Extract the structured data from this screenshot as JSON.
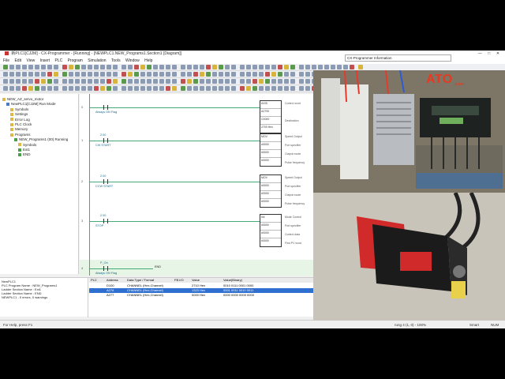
{
  "window": {
    "title": "新PLC1[CJ2M] - CX-Programmer - [Running] - [NEWPLC1.NEW_Programs1.Section1 [Diagram]]",
    "controls": [
      "—",
      "□",
      "✕"
    ]
  },
  "menu": [
    "File",
    "Edit",
    "View",
    "Insert",
    "PLC",
    "Program",
    "Simulation",
    "Tools",
    "Window",
    "Help"
  ],
  "dialog_title": "CX-Programmer Information",
  "tree": [
    {
      "label": "NEW_AZ_servo_motor",
      "indent": 0,
      "icon": "folder"
    },
    {
      "label": "NewPLC1[CJ2M] Run Mode",
      "indent": 1,
      "icon": "plc"
    },
    {
      "label": "Symbols",
      "indent": 2,
      "icon": "table"
    },
    {
      "label": "Settings",
      "indent": 2,
      "icon": "table"
    },
    {
      "label": "Error Log",
      "indent": 2,
      "icon": "table"
    },
    {
      "label": "PLC Clock",
      "indent": 2,
      "icon": "table"
    },
    {
      "label": "Memory",
      "indent": 2,
      "icon": "table"
    },
    {
      "label": "Programs",
      "indent": 2,
      "icon": "folder"
    },
    {
      "label": "NEW_Programs1 (00) Running",
      "indent": 3,
      "icon": "prog"
    },
    {
      "label": "Symbols",
      "indent": 4,
      "icon": "table"
    },
    {
      "label": "Ext1",
      "indent": 4,
      "icon": "prog"
    },
    {
      "label": "END",
      "indent": 4,
      "icon": "prog"
    }
  ],
  "rungs": [
    {
      "num": "0",
      "contact_addr": "",
      "contact_name": "Always ON Flag",
      "block": [
        "AXIS",
        "A2700",
        "C0000",
        "2700 Hex"
      ],
      "notes": [
        "Control word",
        "",
        "Destination",
        ""
      ]
    },
    {
      "num": "1",
      "contact_addr": "2.00",
      "contact_name": "CW START",
      "block": [
        "MOV",
        "#0000",
        "#0000",
        "#0000"
      ],
      "notes": [
        "Speed Output",
        "Port specifier",
        "Output mode",
        "Pulse frequency"
      ]
    },
    {
      "num": "2",
      "contact_addr": "2.00",
      "contact_name": "CCW START",
      "block": [
        "MOV",
        "#0000",
        "#0000",
        "#0000"
      ],
      "notes": [
        "Speed Output",
        "Port specifier",
        "Output mode",
        "Pulse frequency"
      ]
    },
    {
      "num": "3",
      "contact_addr": "2.00",
      "contact_name": "STOP",
      "block": [
        "INI",
        "#0000",
        "#0000",
        "#0000"
      ],
      "notes": [
        "Mode Control",
        "Port specifier",
        "Control data",
        "First PV word"
      ]
    },
    {
      "num": "4",
      "contact_addr": "P_On",
      "contact_name": "Always ON Flag",
      "block": [
        "END"
      ],
      "notes": []
    }
  ],
  "info_panel": [
    "NewPLC1",
    "PLC Program Name : NEW_Programs1",
    "Ladder Section Name : Ext1",
    "Ladder Section Name : END",
    "NEWPLC1 - 0 errors, 0 warnings"
  ],
  "watch": {
    "headers": [
      "PLC",
      "Address",
      "Data Type / Format",
      "FB I/O",
      "Value",
      "Value(Binary)"
    ],
    "rows": [
      {
        "plc": "",
        "addr": "D100",
        "type": "CHANNEL (Hex,Channel)",
        "fb": "",
        "val": "2710 Hex",
        "bin": "0010 0111 0001 0000",
        "sel": false
      },
      {
        "plc": "",
        "addr": "A276",
        "type": "CHANNEL (Hex,Channel)",
        "fb": "",
        "val": "1323 Hex",
        "bin": "0001 0011 0010 0011",
        "sel": true
      },
      {
        "plc": "",
        "addr": "A277",
        "type": "CHANNEL (Hex,Channel)",
        "fb": "",
        "val": "0000 Hex",
        "bin": "0000 0000 0000 0000",
        "sel": false
      }
    ]
  },
  "status": {
    "left": "For Help, press F1",
    "right1": "rung 4 (1, 0) - 100%",
    "right2": "Smart",
    "right3": "NUM"
  },
  "watermark": {
    "brand": "ATO",
    "suffix": ".com"
  },
  "colors": {
    "accent": "#2f6fd0",
    "ladder_green": "#44aa77",
    "brand_red": "#e53a20"
  }
}
